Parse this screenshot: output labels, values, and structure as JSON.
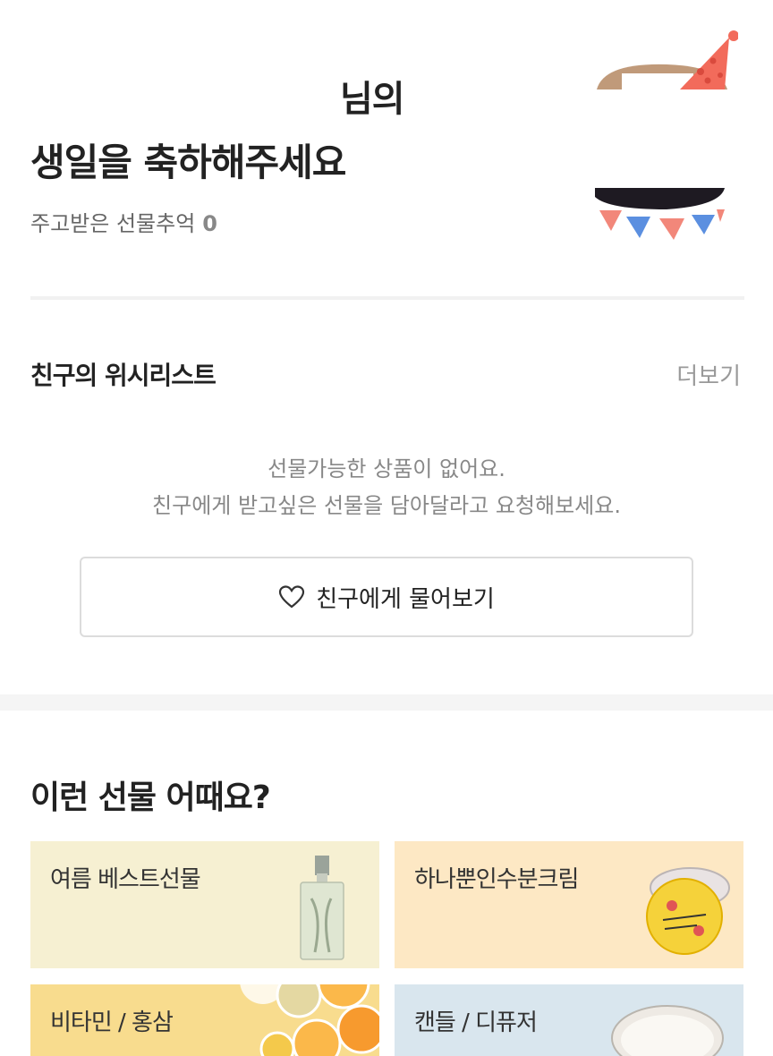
{
  "header": {
    "name_suffix": "님의",
    "title": "생일을 축하해주세요",
    "memory_label": "주고받은 선물추억",
    "memory_count": "0"
  },
  "wishlist": {
    "title": "친구의 위시리스트",
    "more": "더보기",
    "empty_line1": "선물가능한 상품이 없어요.",
    "empty_line2": "친구에게 받고싶은 선물을 담아달라고 요청해보세요.",
    "ask_button": "친구에게 물어보기"
  },
  "suggestions": {
    "title": "이런 선물 어때요?",
    "cards": [
      {
        "label": "여름 베스트선물"
      },
      {
        "label": "하나뿐인수분크림"
      },
      {
        "label": "비타민 / 홍삼"
      },
      {
        "label": "캔들 / 디퓨저"
      }
    ]
  },
  "colors": {
    "card1_bg": "#f6f0d2",
    "card2_bg": "#fde8c4",
    "card3_bg": "#f8dc8e",
    "card4_bg": "#d9e6ee",
    "party_hat": "#f26b5b",
    "bunting_red": "#f2877a",
    "bunting_blue": "#5b8fe0"
  }
}
